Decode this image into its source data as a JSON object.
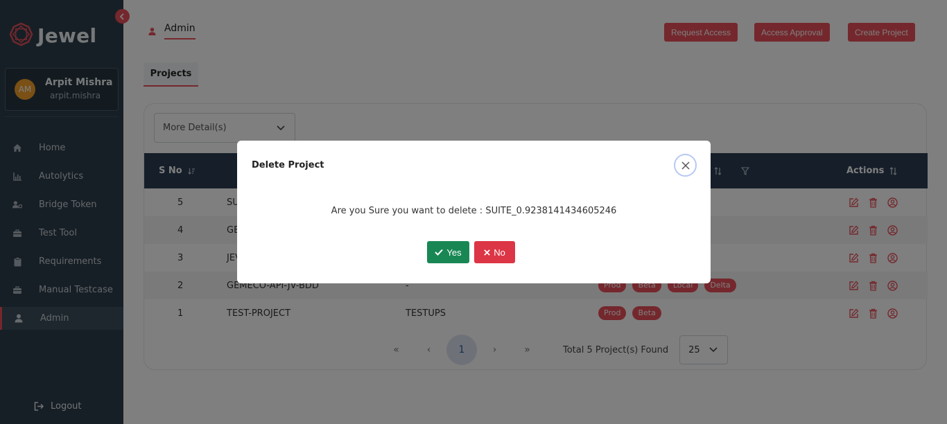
{
  "app": {
    "name": "Jewel"
  },
  "user": {
    "initials": "AM",
    "name": "Arpit Mishra",
    "username": "arpit.mishra"
  },
  "nav": [
    {
      "label": "Home",
      "icon": "home-icon"
    },
    {
      "label": "Autolytics",
      "icon": "bar-chart-icon"
    },
    {
      "label": "Bridge Token",
      "icon": "users-cog-icon"
    },
    {
      "label": "Test Tool",
      "icon": "toolbox-icon"
    },
    {
      "label": "Requirements",
      "icon": "clipboard-icon"
    },
    {
      "label": "Manual Testcase",
      "icon": "briefcase-icon"
    },
    {
      "label": "Admin",
      "icon": "user-icon",
      "active": true
    }
  ],
  "logout_label": "Logout",
  "header": {
    "breadcrumb": "Admin",
    "buttons": {
      "request_access": "Request Access",
      "access_approval": "Access Approval",
      "create_project": "Create Project"
    }
  },
  "tabs": {
    "projects": "Projects"
  },
  "filter": {
    "more_details": "More Detail(s)"
  },
  "table": {
    "headers": {
      "sno": "S No",
      "actions": "Actions"
    },
    "rows": [
      {
        "sno": "5",
        "name": "SU",
        "code": "",
        "envs": []
      },
      {
        "sno": "4",
        "name": "GE",
        "code": "",
        "envs": []
      },
      {
        "sno": "3",
        "name": "JEV",
        "code": "",
        "envs": []
      },
      {
        "sno": "2",
        "name": "GEMECO-API-JV-BDD",
        "code": "-",
        "envs": [
          "Prod",
          "Beta",
          "Local",
          "Delta"
        ]
      },
      {
        "sno": "1",
        "name": "TEST-PROJECT",
        "code": "TESTUPS",
        "envs": [
          "Prod",
          "Beta"
        ]
      }
    ]
  },
  "pagination": {
    "first": "«",
    "prev": "‹",
    "current": "1",
    "next": "›",
    "last": "»",
    "total_text": "Total 5 Project(s) Found",
    "page_size": "25"
  },
  "modal": {
    "title": "Delete Project",
    "message": "Are you Sure you want to delete : SUITE_0.9238141434605246",
    "yes_label": "Yes",
    "no_label": "No"
  },
  "colors": {
    "accent": "#e8505b",
    "sidebar": "#2e3f4c",
    "table_header": "#2d3f52",
    "yes": "#198754",
    "no": "#dc3545"
  }
}
